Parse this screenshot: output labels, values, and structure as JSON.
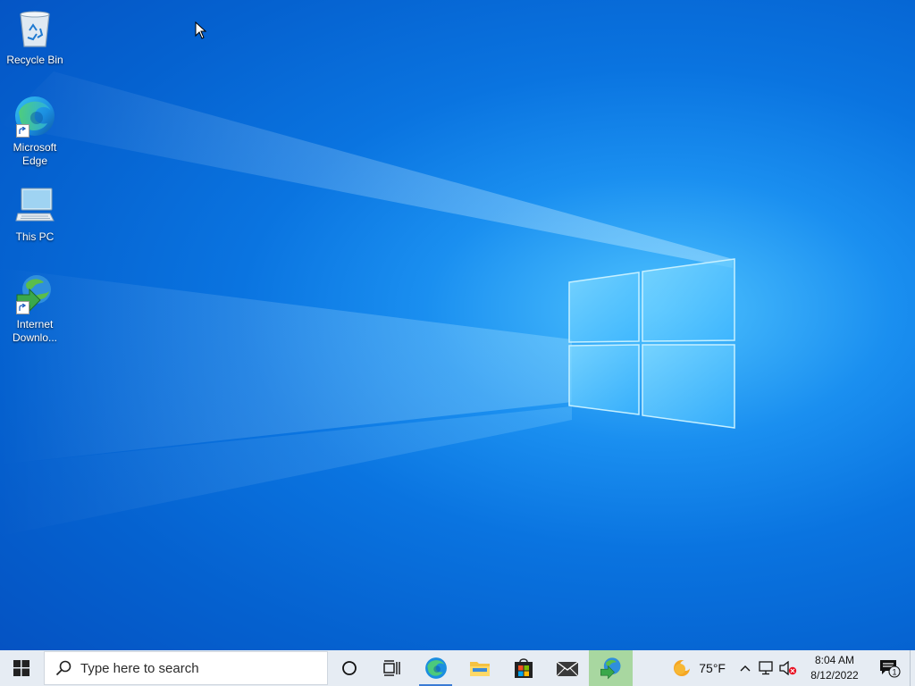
{
  "desktop": {
    "icons": [
      {
        "label": "Recycle Bin",
        "icon": "recycle-bin-icon"
      },
      {
        "label": "Microsoft Edge",
        "icon": "edge-icon"
      },
      {
        "label": "This PC",
        "icon": "this-pc-icon"
      },
      {
        "label": "Internet Downlo...",
        "icon": "internet-download-manager-icon"
      }
    ]
  },
  "taskbar": {
    "search_placeholder": "Type here to search",
    "pinned_apps": [
      {
        "name": "Microsoft Edge",
        "icon": "edge-icon",
        "state": "running"
      },
      {
        "name": "File Explorer",
        "icon": "folder-icon",
        "state": "pinned"
      },
      {
        "name": "Microsoft Store",
        "icon": "store-icon",
        "state": "pinned"
      },
      {
        "name": "Mail",
        "icon": "mail-icon",
        "state": "pinned"
      },
      {
        "name": "Internet Download Manager",
        "icon": "internet-download-manager-icon",
        "state": "highlighted"
      }
    ],
    "weather": {
      "temp": "75°F",
      "icon": "weather-sun-icon"
    },
    "clock": {
      "time": "8:04 AM",
      "date": "8/12/2022"
    },
    "notifications": {
      "count": "1"
    }
  },
  "colors": {
    "taskbar_bg": "#e6ecf3",
    "accent": "#0078d7",
    "highlight": "#a8d7a0"
  }
}
